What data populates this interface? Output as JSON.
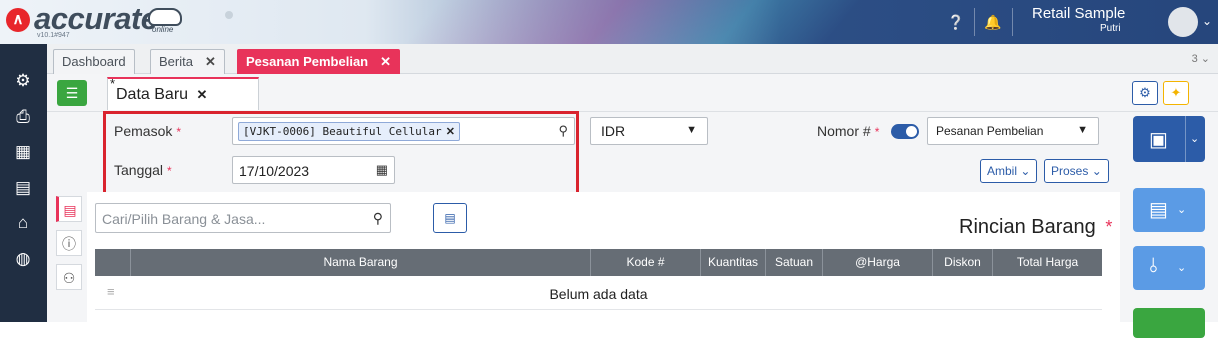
{
  "header": {
    "brand": "accurate",
    "brand_sub": "online",
    "version": "v10.1#947",
    "company": "Retail Sample",
    "user": "Putri",
    "icons": [
      "help-icon",
      "bell-icon",
      "avatar",
      "chevron-down-icon"
    ]
  },
  "left_nav": {
    "icons": [
      "gear-icon",
      "printer-icon",
      "building-icon",
      "clipboard-icon",
      "bank-icon",
      "money-bag-icon"
    ]
  },
  "tabs": [
    {
      "label": "Dashboard",
      "closable": false,
      "active": false
    },
    {
      "label": "Berita",
      "closable": true,
      "active": false
    },
    {
      "label": "Pesanan Pembelian",
      "closable": true,
      "active": true
    }
  ],
  "tab_count": "3",
  "doc_tab": {
    "label": "Data Baru",
    "modified_marker": "*"
  },
  "form": {
    "pemasok_label": "Pemasok",
    "required_marker": "*",
    "pemasok_value": "[VJKT-0006] Beautiful Cellular",
    "tanggal_label": "Tanggal",
    "tanggal_value": "17/10/2023",
    "currency": "IDR",
    "nomor_label": "Nomor #",
    "nomor_value": "Pesanan Pembelian",
    "ambil_label": "Ambil",
    "proses_label": "Proses"
  },
  "items": {
    "search_placeholder": "Cari/Pilih Barang & Jasa...",
    "title": "Rincian Barang",
    "columns": [
      "Nama Barang",
      "Kode #",
      "Kuantitas",
      "Satuan",
      "@Harga",
      "Diskon",
      "Total Harga"
    ],
    "empty_text": "Belum ada data"
  },
  "colors": {
    "accent": "#e8335a",
    "primary": "#2c5ca8",
    "nav_bg": "#202e42",
    "highlight_box": "#d9232e"
  }
}
